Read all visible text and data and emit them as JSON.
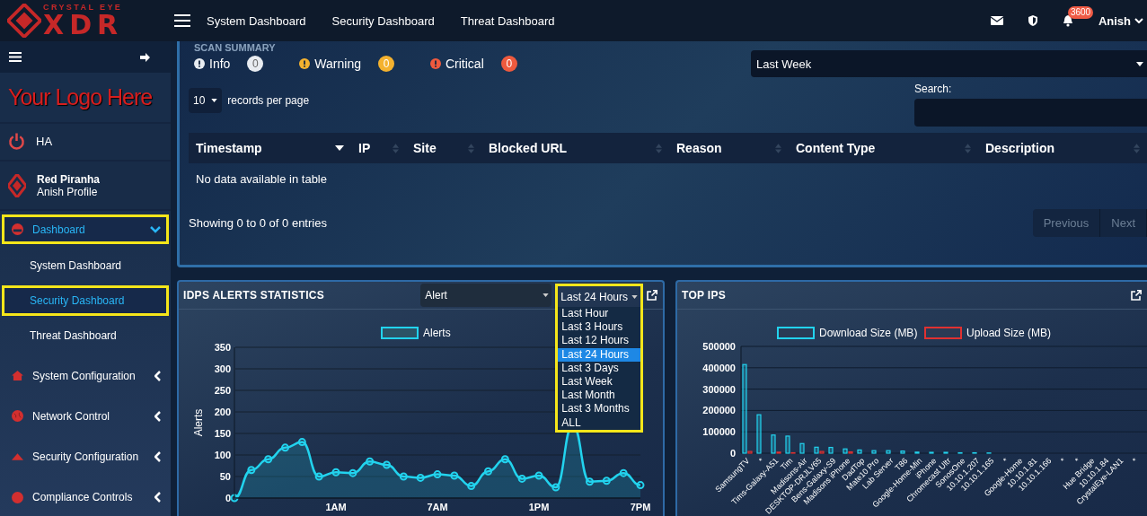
{
  "brand": {
    "top": "CRYSTAL EYE",
    "main": "XDR"
  },
  "top_nav": [
    {
      "label": "System Dashboard"
    },
    {
      "label": "Security Dashboard"
    },
    {
      "label": "Threat Dashboard"
    }
  ],
  "notifications": {
    "count": "3600"
  },
  "user": {
    "name": "Anish"
  },
  "sidebar": {
    "logo_text": "Your Logo Here",
    "ha": "HA",
    "profile": {
      "name": "Red Piranha",
      "subtitle": "Anish Profile"
    },
    "items": [
      {
        "label": "Dashboard",
        "selected": true,
        "expanded": true,
        "children": [
          {
            "label": "System Dashboard",
            "selected": false
          },
          {
            "label": "Security Dashboard",
            "selected": true
          },
          {
            "label": "Threat Dashboard",
            "selected": false
          }
        ]
      },
      {
        "label": "System Configuration",
        "selected": false,
        "expanded": false
      },
      {
        "label": "Network Control",
        "selected": false,
        "expanded": false
      },
      {
        "label": "Security Configuration",
        "selected": false,
        "expanded": false
      },
      {
        "label": "Compliance Controls",
        "selected": false,
        "expanded": false
      }
    ]
  },
  "scan_summary": {
    "title": "SCAN SUMMARY",
    "severities": [
      {
        "label": "Info",
        "count": "0",
        "color": "#e8ecf1"
      },
      {
        "label": "Warning",
        "count": "0",
        "color": "#f4b22f"
      },
      {
        "label": "Critical",
        "count": "0",
        "color": "#ee5a3e"
      }
    ],
    "period": "Last Week",
    "page_size": "10",
    "page_size_label": "records per page",
    "search_label": "Search:",
    "table": {
      "columns": [
        {
          "label": "Timestamp",
          "sorted": true
        },
        {
          "label": "IP",
          "sorted": false
        },
        {
          "label": "Site",
          "sorted": false
        },
        {
          "label": "Blocked URL",
          "sorted": false
        },
        {
          "label": "Reason",
          "sorted": false
        },
        {
          "label": "Content Type",
          "sorted": false
        },
        {
          "label": "Description",
          "sorted": false
        }
      ],
      "empty": "No data available in table"
    },
    "info": "Showing 0 to 0 of 0 entries",
    "pager": [
      {
        "label": "Previous",
        "disabled": true
      },
      {
        "label": "Next",
        "disabled": true
      }
    ]
  },
  "idps": {
    "title": "IDPS ALERTS STATISTICS",
    "type_select": "Alert",
    "range_select": "Last 24 Hours",
    "range_options": [
      {
        "label": "Last Hour",
        "selected": false
      },
      {
        "label": "Last 3 Hours",
        "selected": false
      },
      {
        "label": "Last 12 Hours",
        "selected": false
      },
      {
        "label": "Last 24 Hours",
        "selected": true
      },
      {
        "label": "Last 3 Days",
        "selected": false
      },
      {
        "label": "Last Week",
        "selected": false
      },
      {
        "label": "Last Month",
        "selected": false
      },
      {
        "label": "Last 3 Months",
        "selected": false
      },
      {
        "label": "ALL",
        "selected": false
      }
    ],
    "chart_data": {
      "type": "area",
      "ylabel": "Alerts",
      "legend": "top",
      "grid": true,
      "categories": [
        null,
        null,
        null,
        null,
        null,
        null,
        "1AM",
        null,
        null,
        null,
        null,
        null,
        "7AM",
        null,
        null,
        null,
        null,
        null,
        "1PM",
        null,
        null,
        null,
        null,
        null,
        "7PM"
      ],
      "series": [
        {
          "name": "Alerts",
          "color": "#22d3ee",
          "values": [
            0,
            65,
            90,
            117,
            130,
            50,
            60,
            58,
            85,
            77,
            50,
            47,
            55,
            52,
            28,
            62,
            90,
            45,
            52,
            25,
            170,
            38,
            40,
            58,
            30
          ]
        }
      ],
      "ylim": [
        0,
        350
      ],
      "yticks": [
        0,
        50,
        100,
        150,
        200,
        250,
        300,
        350
      ]
    }
  },
  "top_ips": {
    "title": "TOP IPS",
    "chart_data": {
      "type": "bar",
      "legend": "top",
      "grid": true,
      "categories": [
        "SamsungTV",
        "*",
        "Tims-Galaxy-A51",
        "Tim",
        "Madisons-Air",
        "DESKTOP-DRJLV65",
        "Bens-Galaxy-S9",
        "Madisons iPhone",
        "DadTop",
        "Mate10 Pro",
        "Lab Server",
        "T86",
        "Google-Home-Min",
        "iPhone",
        "Chromecast Ultr",
        "SonosOne",
        "10.10.1.207",
        "10.10.1.165",
        "*",
        "Google-Home",
        "10.10.1.81",
        "10.10.1.166",
        "*",
        "*",
        "Hue Bridge",
        "10.10.1.84",
        "CrystalEye-LAN1",
        "*"
      ],
      "series": [
        {
          "name": "Download Size (MB)",
          "color": "#22d3ee",
          "values": [
            415000,
            180000,
            85000,
            80000,
            45000,
            28000,
            27000,
            20000,
            15000,
            12000,
            12000,
            10000,
            5000,
            4000,
            4000,
            2000,
            2000,
            1000,
            0,
            0,
            0,
            0,
            0,
            0,
            0,
            0,
            0,
            0
          ]
        },
        {
          "name": "Upload Size (MB)",
          "color": "#e03131",
          "values": [
            8000,
            0,
            5000,
            2000,
            0,
            8000,
            0,
            6000,
            0,
            0,
            0,
            0,
            0,
            0,
            0,
            0,
            0,
            0,
            0,
            0,
            0,
            0,
            0,
            0,
            0,
            0,
            0,
            0
          ]
        }
      ],
      "ylim": [
        0,
        500000
      ],
      "yticks": [
        0,
        100000,
        200000,
        300000,
        400000,
        500000
      ]
    }
  }
}
